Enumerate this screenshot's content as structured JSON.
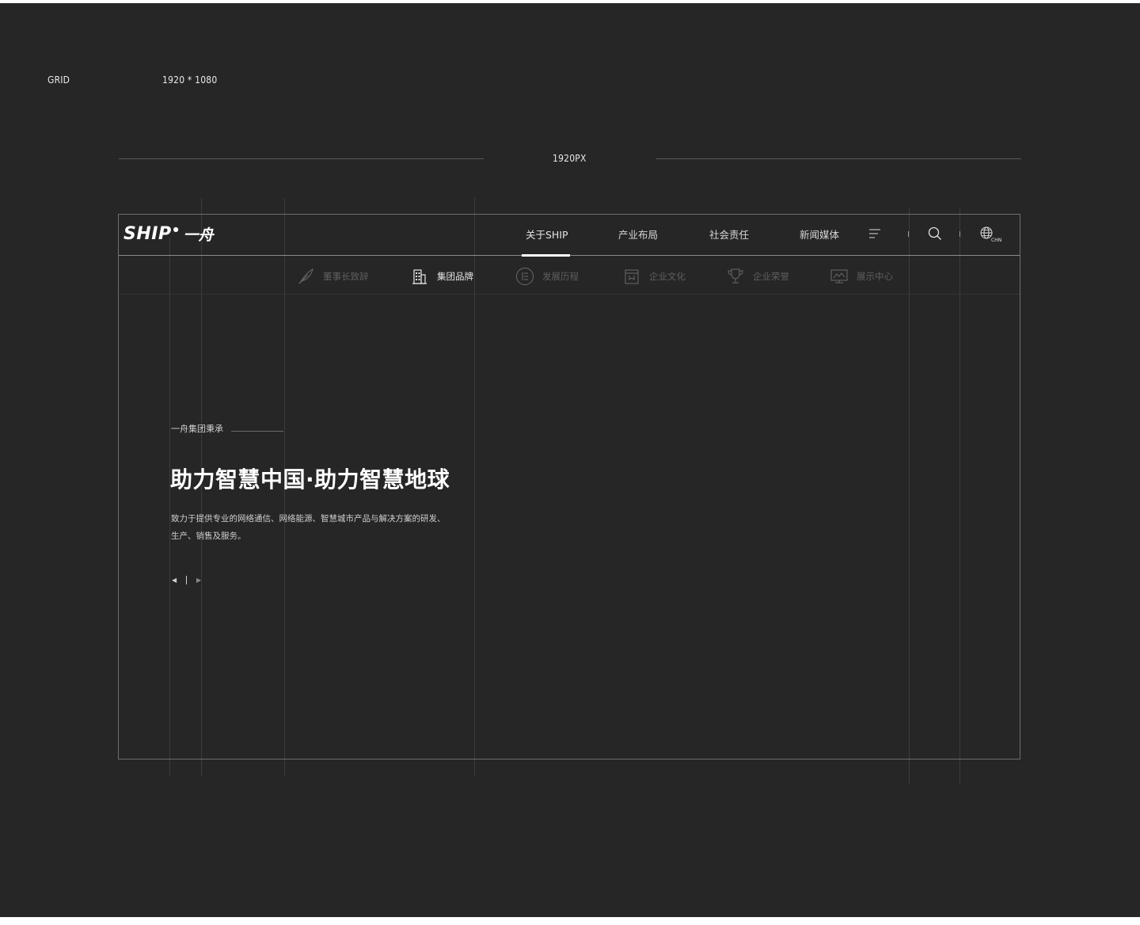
{
  "spec": {
    "grid_label": "GRID",
    "resolution": "1920 * 1080",
    "width_label": "1920PX"
  },
  "header": {
    "logo_en": "SHIP",
    "logo_cn": "一舟",
    "nav": [
      {
        "label": "关于SHIP",
        "active": true
      },
      {
        "label": "产业布局",
        "active": false
      },
      {
        "label": "社会责任",
        "active": false
      },
      {
        "label": "新闻媒体",
        "active": false
      }
    ],
    "menu_icon": "menu-lines-icon",
    "search_icon": "search-icon",
    "language_icon": "globe-icon",
    "language_label": "CHN"
  },
  "subnav": [
    {
      "label": "董事长致辞",
      "icon": "feather-pen-icon",
      "active": false
    },
    {
      "label": "集团品牌",
      "icon": "building-icon",
      "active": true
    },
    {
      "label": "发展历程",
      "icon": "timeline-list-icon",
      "active": false
    },
    {
      "label": "企业文化",
      "icon": "book-icon",
      "active": false
    },
    {
      "label": "企业荣誉",
      "icon": "trophy-icon",
      "active": false
    },
    {
      "label": "展示中心",
      "icon": "display-board-icon",
      "active": false
    }
  ],
  "hero": {
    "tag": "一舟集团秉承",
    "title": "助力智慧中国·助力智慧地球",
    "desc_line1": "致力于提供专业的网络通信、网络能源、智慧城市产品与解决方案的研发、",
    "desc_line2": "生产、销售及服务。",
    "prev_icon": "arrow-left-icon",
    "next_icon": "arrow-right-icon"
  },
  "colors": {
    "background": "#262626",
    "text": "#cfcfcf",
    "active": "#ffffff",
    "inactive_sub": "#5f5f5f"
  }
}
